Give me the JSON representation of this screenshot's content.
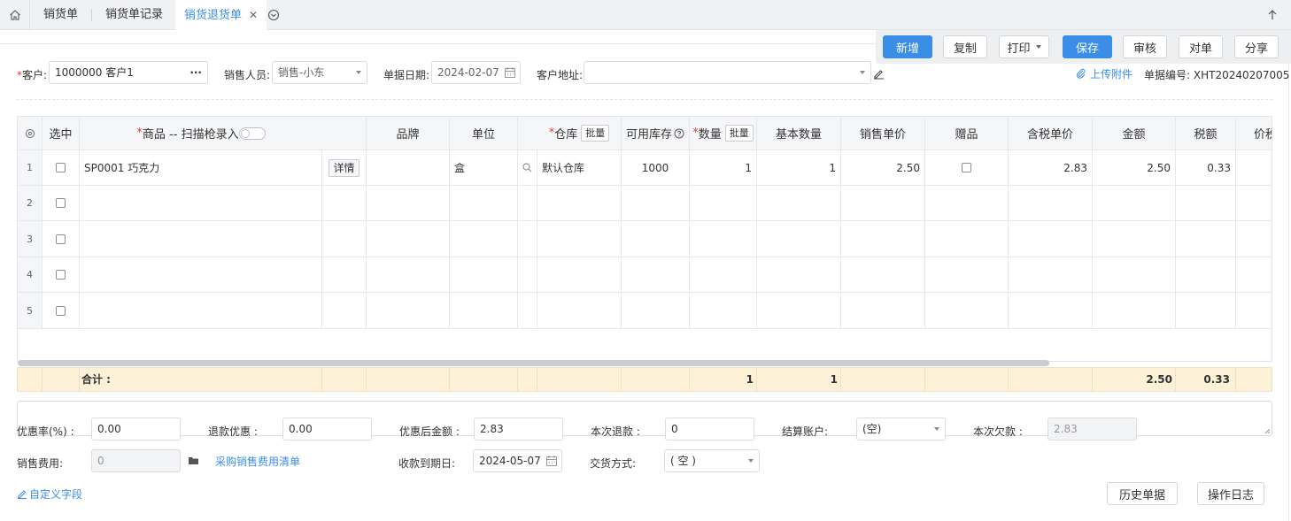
{
  "tabs": [
    {
      "label": "销货单"
    },
    {
      "label": "销货单记录"
    },
    {
      "label": "销货退货单"
    }
  ],
  "icons": {
    "home": "home-icon",
    "close": "close-icon",
    "more": "chevron-circle-down-icon",
    "up": "arrow-up-icon"
  },
  "toolbar": {
    "new_label": "新增",
    "copy_label": "复制",
    "print_label": "打印",
    "save_label": "保存",
    "audit_label": "审核",
    "reconcile_label": "对单",
    "share_label": "分享"
  },
  "header": {
    "customer_label": "客户:",
    "customer_value": "1000000 客户1",
    "customer_more": "···",
    "salesperson_label": "销售人员:",
    "salesperson_value": "销售-小东",
    "date_label": "单据日期:",
    "date_value": "2024-02-07",
    "address_label": "客户地址:",
    "address_value": "",
    "upload_label": "上传附件",
    "doc_no_label": "单据编号:",
    "doc_no_value": "XHT20240207005"
  },
  "grid": {
    "headers": {
      "select": "选中",
      "product": "商品 -- 扫描枪录入",
      "brand": "品牌",
      "unit": "单位",
      "warehouse": "仓库",
      "batch": "批量",
      "stock": "可用库存",
      "qty": "数量",
      "qty_batch": "批量",
      "base_qty": "基本数量",
      "price": "销售单价",
      "gift": "赠品",
      "tax_price": "含税单价",
      "amount": "金额",
      "tax": "税额",
      "tax_total": "价税"
    },
    "rows": [
      {
        "num": "1",
        "product": "SP0001 巧克力",
        "detail": "详情",
        "brand": "",
        "unit": "盒",
        "warehouse": "默认仓库",
        "stock": "1000",
        "qty": "1",
        "base_qty": "1",
        "price": "2.50",
        "tax_price": "2.83",
        "amount": "2.50",
        "tax": "0.33"
      },
      {
        "num": "2"
      },
      {
        "num": "3"
      },
      {
        "num": "4"
      },
      {
        "num": "5"
      }
    ],
    "summary": {
      "label": "合计 :",
      "qty": "1",
      "base_qty": "1",
      "amount": "2.50",
      "tax": "0.33"
    }
  },
  "footer": {
    "discount_rate_label": "优惠率(%) :",
    "discount_rate_value": "0.00",
    "refund_discount_label": "退款优惠 :",
    "refund_discount_value": "0.00",
    "after_discount_label": "优惠后金额 :",
    "after_discount_value": "2.83",
    "this_refund_label": "本次退款 :",
    "this_refund_value": "0",
    "account_label": "结算账户:",
    "account_value": "(空)",
    "this_debt_label": "本次欠款 :",
    "this_debt_value": "2.83",
    "sales_fee_label": "销售费用:",
    "sales_fee_value": "0",
    "fee_list_link": "采购销售费用清单",
    "due_date_label": "收款到期日:",
    "due_date_value": "2024-05-07",
    "delivery_label": "交货方式:",
    "delivery_value": "( 空 )",
    "custom_field_link": "自定义字段",
    "history_label": "历史单据",
    "log_label": "操作日志"
  },
  "colors": {
    "accent": "#3a8ee6",
    "required": "#e4393c",
    "summary_bg": "#fdf1d7"
  }
}
